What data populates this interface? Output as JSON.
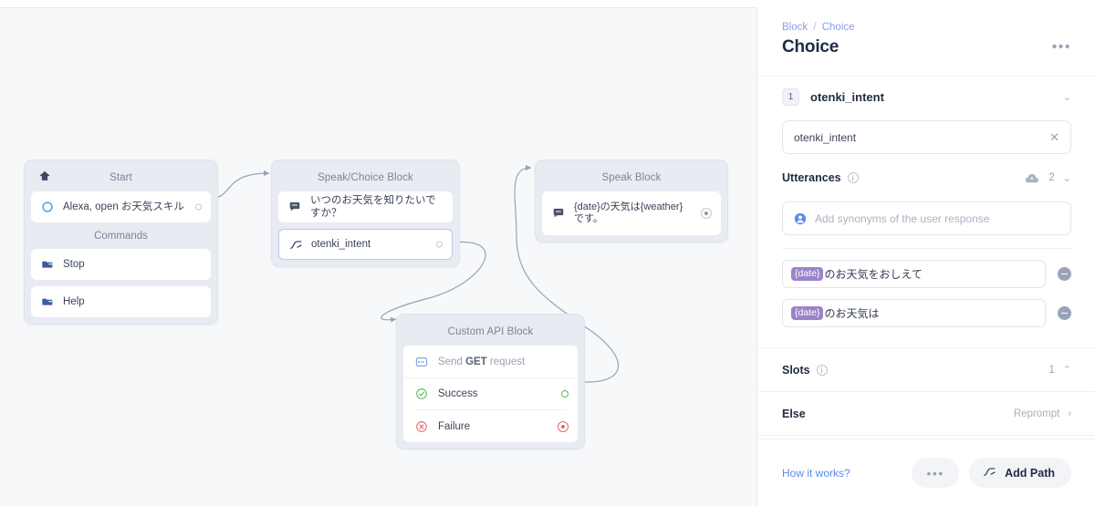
{
  "canvas": {
    "blocks": [
      {
        "id": "start",
        "title": "Start",
        "title_icon": "home-icon",
        "items": [
          {
            "label": "Alexa, open お天気スキル",
            "icon": "circle-outline-icon",
            "port": "hollow"
          }
        ],
        "section_label": "Commands",
        "commands": [
          {
            "label": "Stop",
            "icon": "folder-icon"
          },
          {
            "label": "Help",
            "icon": "folder-icon"
          }
        ]
      },
      {
        "id": "speak-choice",
        "title": "Speak/Choice Block",
        "items": [
          {
            "label": "いつのお天気を知りたいですか？",
            "icon": "speech-bubble-icon"
          },
          {
            "label": "otenki_intent",
            "icon": "path-branch-icon",
            "port": "hollow",
            "selected": true
          }
        ]
      },
      {
        "id": "speak",
        "title": "Speak Block",
        "items": [
          {
            "label": "{date}の天気は{weather} です。",
            "icon": "speech-bubble-icon",
            "port": "bullseye"
          }
        ]
      },
      {
        "id": "custom-api",
        "title": "Custom API Block",
        "rows": [
          {
            "label_prefix": "Send ",
            "label_bold": "GET",
            "label_suffix": " request",
            "icon": "api-request-icon",
            "muted": true
          },
          {
            "label": "Success",
            "icon": "check-circle-icon",
            "port": "green"
          },
          {
            "label": "Failure",
            "icon": "x-circle-icon",
            "port": "red"
          }
        ]
      }
    ]
  },
  "panel": {
    "breadcrumb": {
      "parent": "Block",
      "separator": "/",
      "current": "Choice"
    },
    "title": "Choice",
    "menu_dots": "•••",
    "choice": {
      "number": "1",
      "name": "otenki_intent",
      "chevron": "⌄",
      "input_value": "otenki_intent",
      "clear": "✕"
    },
    "utterances": {
      "label": "Utterances",
      "count": "2",
      "chevron": "⌄",
      "cloud_icon": "cloud-upload-icon",
      "synonyms_placeholder": "Add synonyms of the user response",
      "items": [
        {
          "tag": "{date}",
          "text": "のお天気をおしえて"
        },
        {
          "tag": "{date}",
          "text": "のお天気は"
        }
      ]
    },
    "slots": {
      "label": "Slots",
      "count": "1",
      "chevron": "⌃"
    },
    "else": {
      "label": "Else",
      "value": "Reprompt",
      "chevron": "›"
    },
    "footer": {
      "how_it_works": "How it works?",
      "dots": "•••",
      "add_path": "Add Path"
    }
  },
  "colors": {
    "accent_blue": "#5a8ce8",
    "tag_purple": "#9b83c9",
    "success_green": "#5cb85c",
    "failure_red": "#e26a6a",
    "canvas_bg": "#f7f8fa",
    "block_bg": "#e8ebf2"
  }
}
